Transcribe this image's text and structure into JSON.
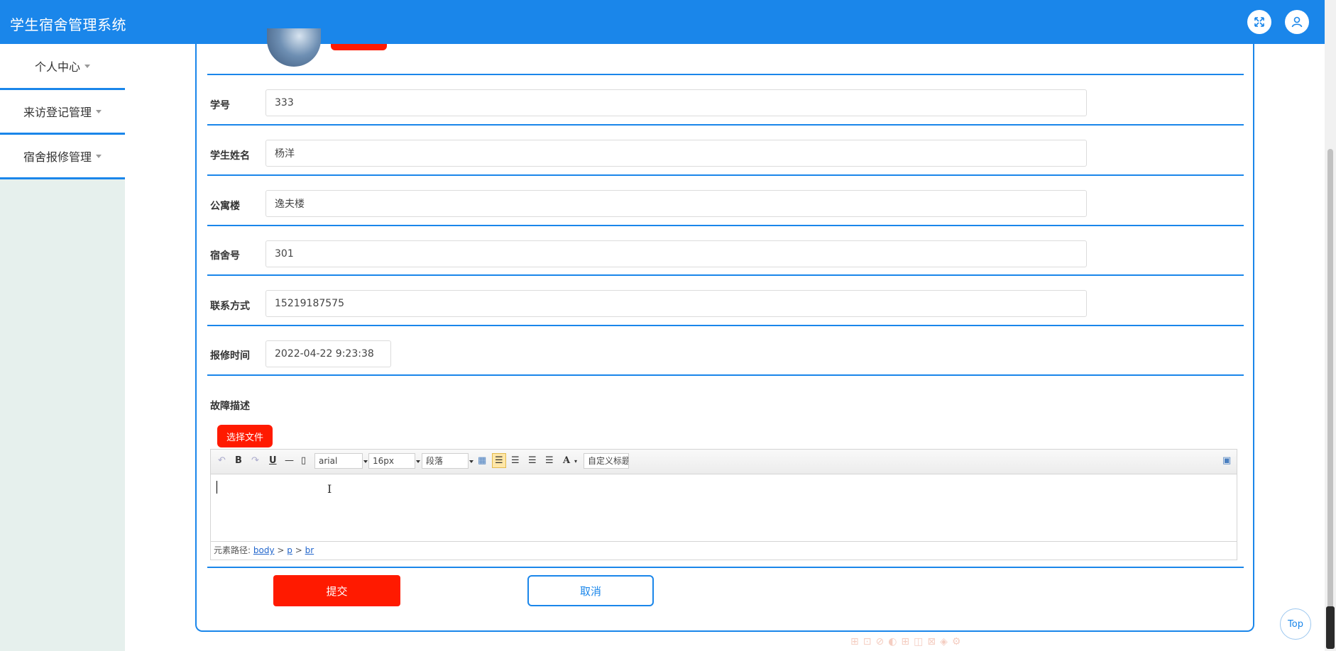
{
  "app": {
    "title": "学生宿舍管理系统"
  },
  "header": {
    "fullscreen_icon": "fullscreen-icon",
    "user_icon": "user-icon"
  },
  "sidebar": {
    "items": [
      {
        "label": "个人中心"
      },
      {
        "label": "来访登记管理"
      },
      {
        "label": "宿舍报修管理"
      }
    ]
  },
  "form": {
    "fields": [
      {
        "label": "学号",
        "value": "333"
      },
      {
        "label": "学生姓名",
        "value": "杨洋"
      },
      {
        "label": "公寓楼",
        "value": "逸夫楼"
      },
      {
        "label": "宿舍号",
        "value": "301"
      },
      {
        "label": "联系方式",
        "value": "15219187575"
      },
      {
        "label": "报修时间",
        "value": "2022-04-22 9:23:38"
      }
    ],
    "description_label": "故障描述",
    "file_button": "选择文件",
    "submit": "提交",
    "cancel": "取消"
  },
  "editor": {
    "font": "arial",
    "size": "16px",
    "paragraph": "段落",
    "custom_title": "自定义标题",
    "path_label": "元素路径:",
    "path": [
      "body",
      "p",
      "br"
    ],
    "path_sep": ">"
  },
  "misc": {
    "top_label": "Top"
  }
}
